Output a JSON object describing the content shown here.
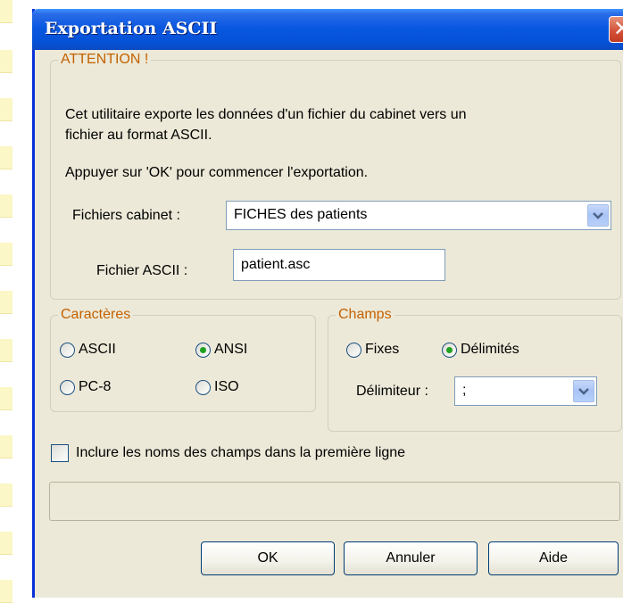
{
  "window": {
    "title": "Exportation ASCII",
    "close_symbol": "✕"
  },
  "attention": {
    "legend": "ATTENTION !",
    "line1": "Cet utilitaire exporte les données d'un fichier du cabinet vers un",
    "line2": "fichier au format ASCII.",
    "line3": "Appuyer sur 'OK' pour commencer l'exportation."
  },
  "fichiers_cabinet": {
    "label": "Fichiers cabinet :",
    "value": "FICHES des patients"
  },
  "fichier_ascii": {
    "label": "Fichier ASCII :",
    "value": "patient.asc"
  },
  "caracteres": {
    "legend": "Caractères",
    "options": [
      {
        "label": "ASCII",
        "selected": false
      },
      {
        "label": "ANSI",
        "selected": true
      },
      {
        "label": "PC-8",
        "selected": false
      },
      {
        "label": "ISO",
        "selected": false
      }
    ]
  },
  "champs": {
    "legend": "Champs",
    "options": [
      {
        "label": "Fixes",
        "selected": false
      },
      {
        "label": "Délimités",
        "selected": true
      }
    ],
    "delimiter_label": "Délimiteur :",
    "delimiter_value": ";"
  },
  "include_header": {
    "label": "Inclure les noms des champs dans la première ligne",
    "checked": false
  },
  "buttons": {
    "ok": "OK",
    "cancel": "Annuler",
    "help": "Aide"
  },
  "colors": {
    "titlebar": "#0a58e0",
    "dialog_bg": "#ece9d8",
    "legend": "#c46100",
    "radio_dot": "#21a121"
  }
}
